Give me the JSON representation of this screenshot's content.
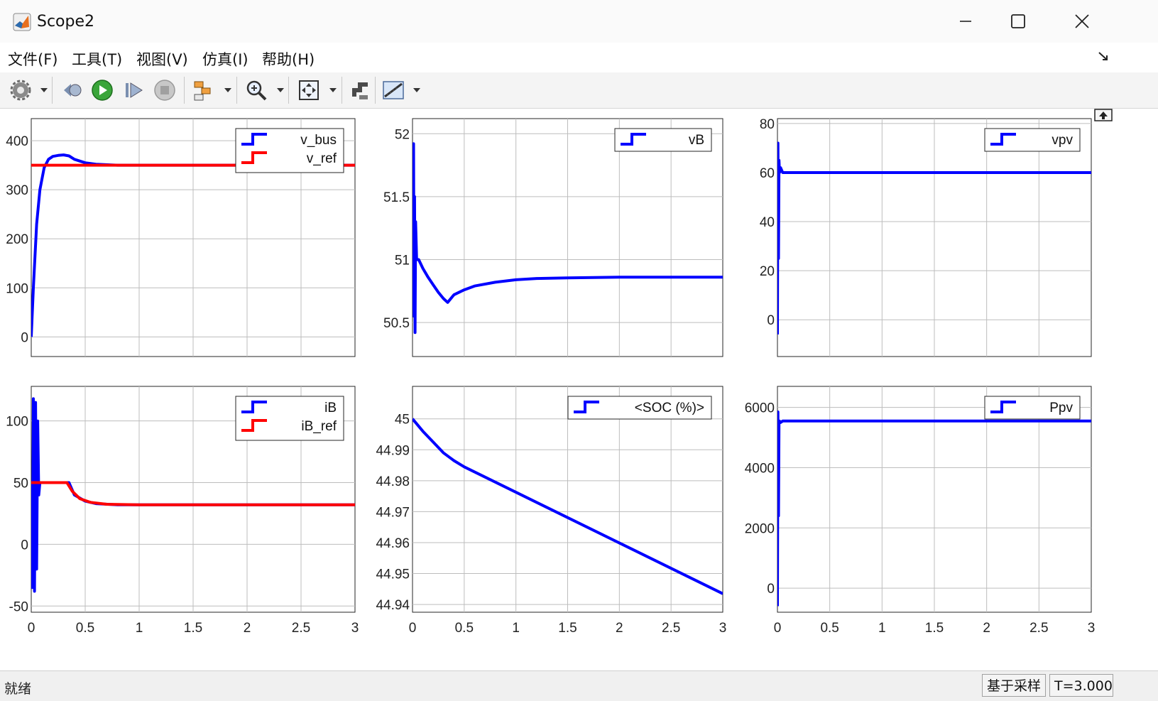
{
  "window": {
    "title": "Scope2",
    "minimize_icon": "minimize-icon",
    "maximize_icon": "maximize-icon",
    "close_icon": "close-icon"
  },
  "menu": {
    "items": [
      "文件(F)",
      "工具(T)",
      "视图(V)",
      "仿真(I)",
      "帮助(H)"
    ]
  },
  "toolbar": {
    "icons": [
      "settings-icon",
      "step-back-icon",
      "run-icon",
      "step-forward-icon",
      "stop-icon",
      "signal-selector-icon",
      "zoom-icon",
      "autoscale-icon",
      "highlight-simulink-block-icon",
      "measurements-icon"
    ]
  },
  "colors": {
    "series_blue": "#0000ff",
    "series_red": "#ff0000",
    "axes_bg": "#ffffff",
    "grid": "#bdbdbd"
  },
  "status": {
    "left": "就绪",
    "sample_mode": "基于采样",
    "time": "T=3.000"
  },
  "chart_data": [
    {
      "type": "line",
      "xlim": [
        0,
        3
      ],
      "ylim": [
        -40,
        445
      ],
      "xticks": [
        "0",
        "0.5",
        "1",
        "1.5",
        "2",
        "2.5",
        "3"
      ],
      "yticks": [
        {
          "v": 0,
          "l": "0"
        },
        {
          "v": 100,
          "l": "100"
        },
        {
          "v": 200,
          "l": "200"
        },
        {
          "v": 300,
          "l": "300"
        },
        {
          "v": 400,
          "l": "400"
        }
      ],
      "show_xticklabels": false,
      "grid": true,
      "legend_position": "top-right",
      "series": [
        {
          "name": "v_bus",
          "color": "#0000ff",
          "x": [
            0,
            0.02,
            0.05,
            0.08,
            0.12,
            0.16,
            0.2,
            0.25,
            0.3,
            0.35,
            0.4,
            0.5,
            0.6,
            0.8,
            1.0,
            1.5,
            2.0,
            2.5,
            3.0
          ],
          "y": [
            0,
            100,
            230,
            300,
            345,
            362,
            368,
            370,
            371,
            369,
            362,
            355,
            352,
            350,
            350,
            350,
            350,
            350,
            350
          ]
        },
        {
          "name": "v_ref",
          "color": "#ff0000",
          "x": [
            0,
            3
          ],
          "y": [
            350,
            350
          ]
        }
      ]
    },
    {
      "type": "line",
      "xlim": [
        0,
        3
      ],
      "ylim": [
        50.23,
        52.12
      ],
      "xticks": [
        "0",
        "0.5",
        "1",
        "1.5",
        "2",
        "2.5",
        "3"
      ],
      "yticks": [
        {
          "v": 50.5,
          "l": "50.5"
        },
        {
          "v": 51,
          "l": "51"
        },
        {
          "v": 51.5,
          "l": "51.5"
        },
        {
          "v": 52,
          "l": "52"
        }
      ],
      "show_xticklabels": false,
      "grid": true,
      "legend_position": "top-right",
      "series": [
        {
          "name": "vB",
          "color": "#0000ff",
          "x": [
            0,
            0.01,
            0.015,
            0.02,
            0.025,
            0.03,
            0.04,
            0.06,
            0.1,
            0.15,
            0.2,
            0.25,
            0.3,
            0.34,
            0.4,
            0.5,
            0.6,
            0.8,
            1.0,
            1.2,
            1.5,
            2.0,
            2.5,
            3.0
          ],
          "y": [
            50.6,
            51.92,
            50.55,
            51.5,
            50.42,
            51.3,
            51.0,
            51.0,
            50.93,
            50.86,
            50.8,
            50.74,
            50.69,
            50.66,
            50.72,
            50.76,
            50.79,
            50.82,
            50.84,
            50.85,
            50.855,
            50.86,
            50.86,
            50.86
          ]
        }
      ]
    },
    {
      "type": "line",
      "xlim": [
        0,
        3
      ],
      "ylim": [
        -15,
        82
      ],
      "xticks": [
        "0",
        "0.5",
        "1",
        "1.5",
        "2",
        "2.5",
        "3"
      ],
      "yticks": [
        {
          "v": 0,
          "l": "0"
        },
        {
          "v": 20,
          "l": "20"
        },
        {
          "v": 40,
          "l": "40"
        },
        {
          "v": 60,
          "l": "60"
        },
        {
          "v": 80,
          "l": "80"
        }
      ],
      "show_xticklabels": false,
      "grid": true,
      "legend_position": "top-right",
      "series": [
        {
          "name": "vpv",
          "color": "#0000ff",
          "x": [
            0,
            0.005,
            0.01,
            0.015,
            0.02,
            0.03,
            0.05,
            0.1,
            0.5,
            1.0,
            1.5,
            2.0,
            2.5,
            3.0
          ],
          "y": [
            -6,
            72,
            25,
            65,
            60,
            62,
            60,
            60,
            60,
            60,
            60,
            60,
            60,
            60
          ]
        }
      ]
    },
    {
      "type": "line",
      "xlim": [
        0,
        3
      ],
      "ylim": [
        -55,
        128
      ],
      "xticks": [
        "0",
        "0.5",
        "1",
        "1.5",
        "2",
        "2.5",
        "3"
      ],
      "yticks": [
        {
          "v": -50,
          "l": "-50"
        },
        {
          "v": 0,
          "l": "0"
        },
        {
          "v": 50,
          "l": "50"
        },
        {
          "v": 100,
          "l": "100"
        }
      ],
      "show_xticklabels": true,
      "grid": true,
      "legend_position": "top-right",
      "series": [
        {
          "name": "iB",
          "color": "#0000ff",
          "x": [
            0,
            0.01,
            0.02,
            0.03,
            0.04,
            0.05,
            0.06,
            0.07,
            0.08,
            0.1,
            0.2,
            0.3,
            0.35,
            0.4,
            0.5,
            0.6,
            0.8,
            1.0,
            1.5,
            2.0,
            2.5,
            3.0
          ],
          "y": [
            50,
            -35,
            118,
            -38,
            115,
            -20,
            100,
            40,
            50,
            50,
            50,
            50,
            50,
            40,
            35,
            33,
            32,
            32,
            32,
            32,
            32,
            32
          ]
        },
        {
          "name": "iB_ref",
          "color": "#ff0000",
          "x": [
            0,
            0.33,
            0.38,
            0.45,
            0.55,
            0.7,
            1.0,
            1.5,
            2.0,
            3.0
          ],
          "y": [
            50,
            50,
            43,
            37,
            34,
            32.5,
            32,
            32,
            32,
            32
          ]
        }
      ]
    },
    {
      "type": "line",
      "xlim": [
        0,
        3
      ],
      "ylim": [
        44.9375,
        45.0105
      ],
      "xticks": [
        "0",
        "0.5",
        "1",
        "1.5",
        "2",
        "2.5",
        "3"
      ],
      "yticks": [
        {
          "v": 44.94,
          "l": "44.94"
        },
        {
          "v": 44.95,
          "l": "44.95"
        },
        {
          "v": 44.96,
          "l": "44.96"
        },
        {
          "v": 44.97,
          "l": "44.97"
        },
        {
          "v": 44.98,
          "l": "44.98"
        },
        {
          "v": 44.99,
          "l": "44.99"
        },
        {
          "v": 45,
          "l": "45"
        }
      ],
      "show_xticklabels": true,
      "grid": true,
      "legend_position": "top-right",
      "series": [
        {
          "name": "<SOC (%)>",
          "color": "#0000ff",
          "x": [
            0,
            0.1,
            0.2,
            0.3,
            0.4,
            0.5,
            3.0
          ],
          "y": [
            45.0,
            44.996,
            44.9925,
            44.989,
            44.9865,
            44.9845,
            44.9435
          ]
        }
      ]
    },
    {
      "type": "line",
      "xlim": [
        0,
        3
      ],
      "ylim": [
        -800,
        6700
      ],
      "xticks": [
        "0",
        "0.5",
        "1",
        "1.5",
        "2",
        "2.5",
        "3"
      ],
      "yticks": [
        {
          "v": 0,
          "l": "0"
        },
        {
          "v": 2000,
          "l": "2000"
        },
        {
          "v": 4000,
          "l": "4000"
        },
        {
          "v": 6000,
          "l": "6000"
        }
      ],
      "show_xticklabels": true,
      "grid": true,
      "legend_position": "top-right",
      "series": [
        {
          "name": "Ppv",
          "color": "#0000ff",
          "x": [
            0,
            0.005,
            0.01,
            0.015,
            0.02,
            0.03,
            0.05,
            0.5,
            1.0,
            2.0,
            3.0
          ],
          "y": [
            -600,
            5850,
            2400,
            5500,
            5550,
            5500,
            5550,
            5550,
            5550,
            5550,
            5550
          ]
        }
      ]
    }
  ]
}
